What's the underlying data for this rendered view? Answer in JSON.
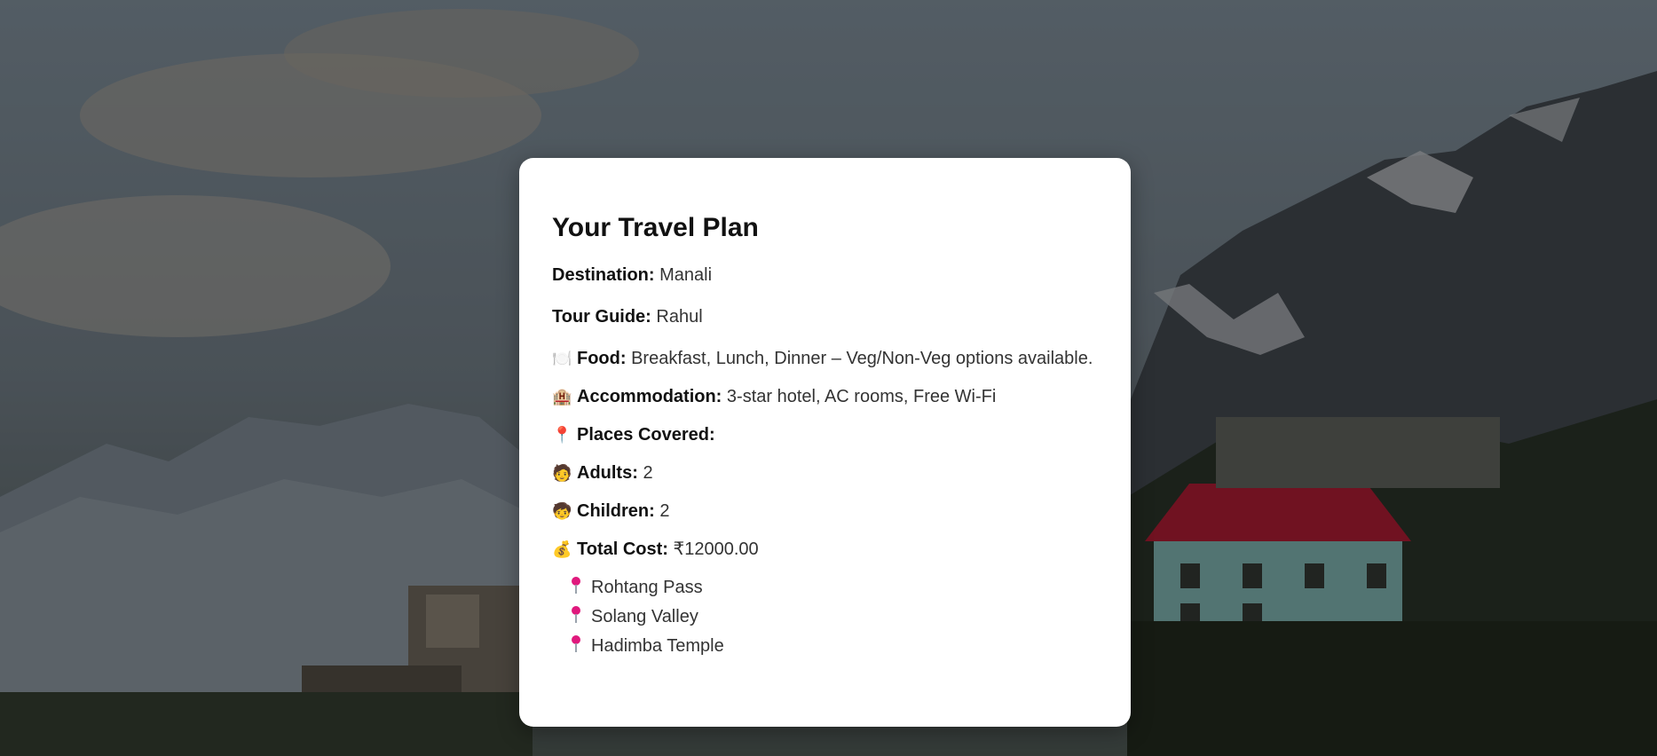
{
  "plan": {
    "title": "Your Travel Plan",
    "destination": {
      "label": "Destination:",
      "value": "Manali"
    },
    "guide": {
      "label": "Tour Guide:",
      "value": "Rahul"
    },
    "food": {
      "icon": "🍽️",
      "label": "Food:",
      "value": "Breakfast, Lunch, Dinner – Veg/Non-Veg options available."
    },
    "accommodation": {
      "icon": "🏨",
      "label": "Accommodation:",
      "value": "3-star hotel, AC rooms, Free Wi-Fi"
    },
    "places": {
      "icon": "📍",
      "label": "Places Covered:"
    },
    "adults": {
      "icon": "🧑",
      "label": "Adults:",
      "value": "2"
    },
    "children": {
      "icon": "🧒",
      "label": "Children:",
      "value": "2"
    },
    "cost": {
      "icon": "💰",
      "label": "Total Cost:",
      "value": "₹12000.00"
    },
    "place_list": [
      "Rohtang Pass",
      "Solang Valley",
      "Hadimba Temple"
    ]
  },
  "colors": {
    "pin": "#e0197d",
    "card": "#ffffff"
  },
  "icons": {
    "food": "plate-icon",
    "accommodation": "hotel-icon",
    "places": "pin-icon",
    "adults": "adult-icon",
    "children": "child-icon",
    "cost": "money-bag-icon"
  }
}
